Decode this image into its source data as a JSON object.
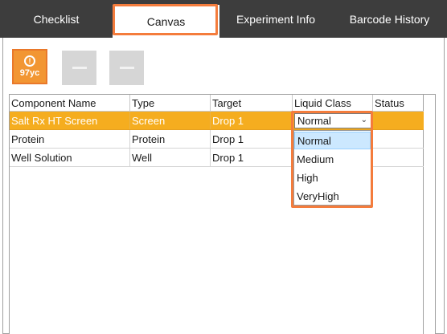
{
  "tabs": [
    {
      "label": "Checklist",
      "active": false
    },
    {
      "label": "Canvas",
      "active": true
    },
    {
      "label": "Experiment Info",
      "active": false
    },
    {
      "label": "Barcode History",
      "active": false
    }
  ],
  "toolbar": {
    "primary_label": "97yc",
    "primary_icon": "exclamation-circle-icon",
    "buttons": [
      "minus-icon",
      "minus-icon"
    ]
  },
  "grid": {
    "columns": [
      "Component Name",
      "Type",
      "Target",
      "Liquid Class",
      "Status"
    ],
    "rows": [
      {
        "name": "Salt Rx HT Screen",
        "type": "Screen",
        "target": "Drop 1",
        "liquid_class": "Normal",
        "status": "",
        "selected": true
      },
      {
        "name": "Protein",
        "type": "Protein",
        "target": "Drop 1",
        "liquid_class": "",
        "status": "",
        "selected": false
      },
      {
        "name": "Well Solution",
        "type": "Well",
        "target": "Drop 1",
        "liquid_class": "",
        "status": "",
        "selected": false
      }
    ]
  },
  "liquid_class_dropdown": {
    "selected": "Normal",
    "options": [
      "Normal",
      "Medium",
      "High",
      "VeryHigh"
    ]
  },
  "colors": {
    "tabbar": "#3d3d3d",
    "highlight": "#f47c3c",
    "selected_row": "#f5ad1f",
    "dropdown_selected": "#cce8ff"
  }
}
